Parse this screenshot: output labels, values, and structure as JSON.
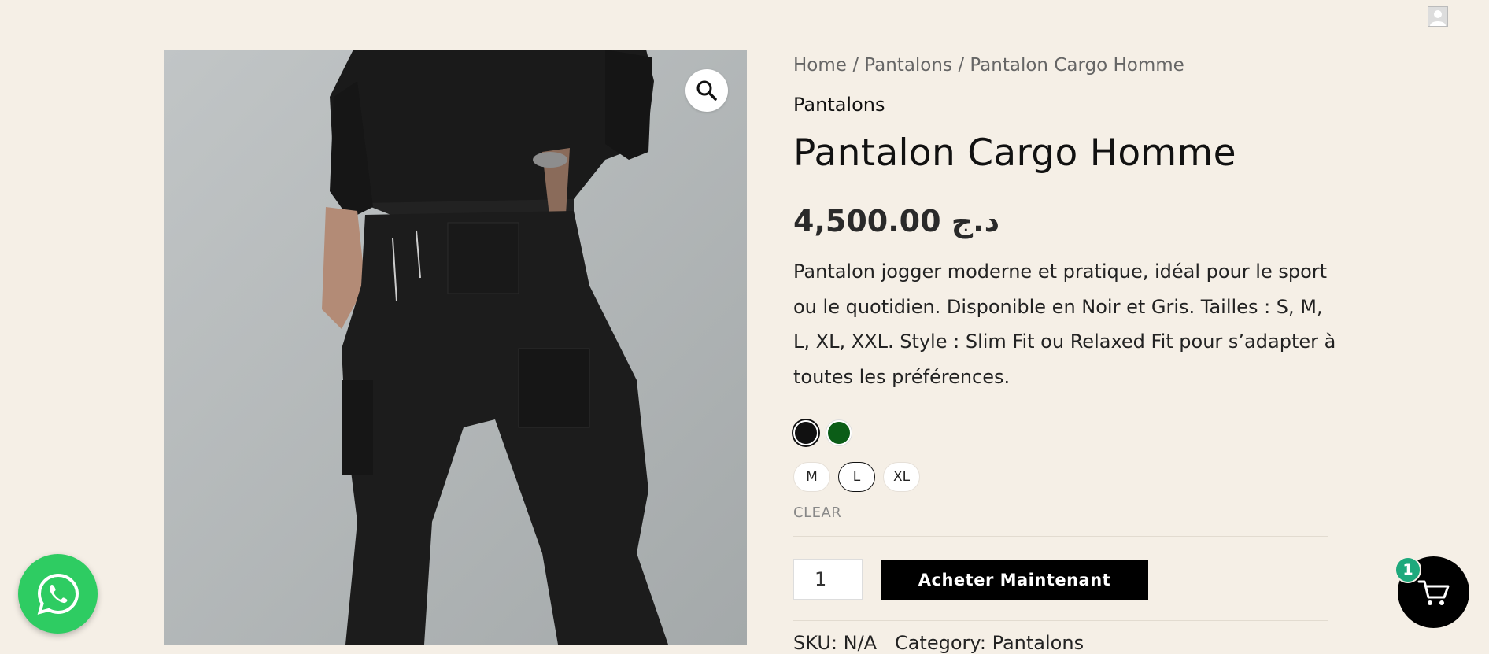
{
  "header": {
    "account_icon": "user-avatar-icon"
  },
  "product": {
    "image_alt": "Pantalon Cargo Homme",
    "zoom_icon": "magnifier-icon",
    "breadcrumb": {
      "home": "Home",
      "sep1": " / ",
      "category": "Pantalons",
      "sep2": " / ",
      "current": "Pantalon Cargo Homme"
    },
    "category": "Pantalons",
    "title": "Pantalon Cargo Homme",
    "price": "4,500.00 د.ج",
    "description": "Pantalon jogger moderne et pratique, idéal pour le sport ou le quotidien. Disponible en Noir et Gris. Tailles : S, M, L, XL, XXL. Style : Slim Fit ou Relaxed Fit pour s’adapter à toutes les préférences.",
    "colors": [
      {
        "hex": "#111111",
        "selected": true
      },
      {
        "hex": "#0b5d17",
        "selected": false
      }
    ],
    "sizes": [
      {
        "label": "M",
        "selected": false
      },
      {
        "label": "L",
        "selected": true
      },
      {
        "label": "XL",
        "selected": false
      }
    ],
    "clear_label": "CLEAR",
    "quantity": "1",
    "buy_label": "Acheter Maintenant",
    "meta": {
      "sku_label": "SKU: ",
      "sku_value": "N/A",
      "category_label": "Category: ",
      "category_value": "Pantalons"
    }
  },
  "floating": {
    "whatsapp_icon": "whatsapp-icon",
    "cart_icon": "cart-icon",
    "cart_count": "1"
  },
  "colors": {
    "background": "#f5efe6",
    "button": "#000000",
    "whatsapp": "#2ecc62",
    "badge": "#1ea97c"
  }
}
